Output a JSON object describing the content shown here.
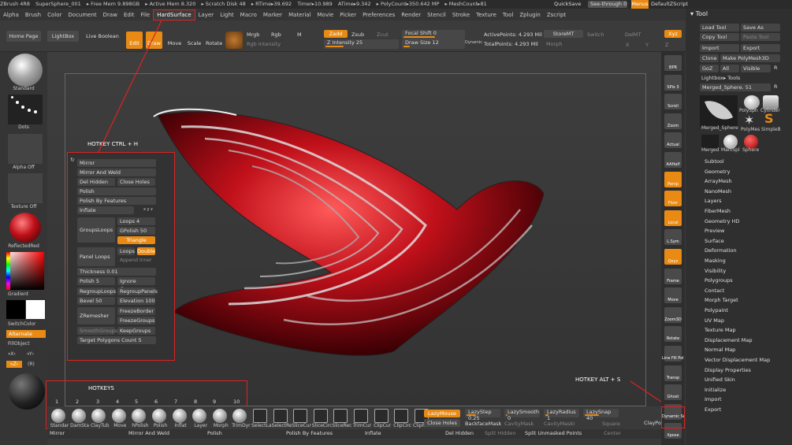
{
  "topbar": {
    "items": [
      "ZBrush 4R8",
      "SuperSphere_001",
      "▸ Free Mem 9.898GB",
      "▸ Active Mem 8.320",
      "▸ Scratch Disk 48",
      "▸ RTime▸39.692",
      "Timer▸10.989",
      "ATime▸9.342",
      "▸ PolyCount▸350.642 MP",
      "▸ MeshCount▸81"
    ],
    "quicksave": "QuickSave",
    "seethrough": "See-through  0",
    "menus": "Menus",
    "default_script": "DefaultZScript"
  },
  "menubar": [
    "Alpha",
    "Brush",
    "Color",
    "Document",
    "Draw",
    "Edit",
    "File",
    "HardSurface",
    "Layer",
    "Light",
    "Macro",
    "Marker",
    "Material",
    "Movie",
    "Picker",
    "Preferences",
    "Render",
    "Stencil",
    "Stroke",
    "Texture",
    "Tool",
    "Zplugin",
    "Zscript"
  ],
  "shelf": {
    "home": "Home Page",
    "lightbox": "LightBox",
    "live_boolean": "Live Boolean",
    "edit": "Edit",
    "draw": "Draw",
    "move": "Move",
    "scale": "Scale",
    "rotate": "Rotate",
    "mrgb": "Mrgb",
    "rgb": "Rgb",
    "m": "M",
    "rgb_intensity": "Rgb Intensity",
    "zadd": "Zadd",
    "zsub": "Zsub",
    "zcut": "Zcut",
    "z_intensity": "Z Intensity 25",
    "z_intensity_value": 25,
    "focal_shift": "Focal Shift 0",
    "draw_size": "Draw Size 12",
    "dynamic": "Dynamic",
    "active_points": "ActivePoints: 4.293 Mil",
    "total_points": "TotalPoints: 4.293 Mil",
    "storemt": "StoreMT",
    "switch": "Switch",
    "delmt": "DelMT",
    "morph": "Morph",
    "xyz": "Xyz",
    "x": "X",
    "y": "Y",
    "z": "Z"
  },
  "left": {
    "standard": "Standard",
    "dots": "Dots",
    "alpha_off": "Alpha Off",
    "texture_off": "Texture Off",
    "reflected_red": "ReflectedRed",
    "gradient": "Gradient",
    "switch_color": "SwitchColor",
    "alternate": "Alternate",
    "fill_object": "FillObject",
    "mx": "»X‹",
    "my": "»Y‹",
    "mz": "»Z‹",
    "mr": "(R)"
  },
  "colors": {
    "accent": "#e88a14",
    "highlight": "#dd2222",
    "model": "#c0101a"
  },
  "hotkey_ctrl_h": "HOTKEY CTRL + H",
  "hotkey_alt_s": "HOTKEY ALT + S",
  "hotkeys_label": "HOTKEYS",
  "popup": {
    "mirror": "Mirror",
    "mirror_weld": "Mirror And Weld",
    "del_hidden": "Del Hidden",
    "close_holes": "Close Holes",
    "polish": "Polish",
    "polish_features": "Polish By Features",
    "inflate": "Inflate",
    "xyz": "x y z",
    "loops": "Loops 4",
    "gpolish": "GPolish 50",
    "triangle": "Triangle",
    "groups_loops": "GroupsLoops",
    "loops2": "Loops",
    "double": "Double",
    "append": "Append",
    "inner": "Inner",
    "panel_loops": "Panel Loops",
    "thickness": "Thickness 0.01",
    "polish5": "Polish 5",
    "ignore_groups": "Ignore Groups",
    "regroup_loops": "RegroupLoops",
    "regroup_panels": "RegroupPanels",
    "bevel": "Bevel 50",
    "elevation": "Elevation 100",
    "freeze_border": "FreezeBorder",
    "zremesher": "ZRemesher",
    "freeze_groups": "FreezeGroups",
    "smooth_groups": "SmoothGroups",
    "keep_groups": "KeepGroups",
    "target_polygons": "Target Polygons Count 5"
  },
  "brushes": {
    "numbers": [
      "1",
      "2",
      "3",
      "4",
      "5",
      "6",
      "7",
      "8",
      "9",
      "10"
    ],
    "names": [
      "Standar",
      "DamSta",
      "ClayTub",
      "Move",
      "hPolish",
      "Polish",
      "Inflat",
      "Layer",
      "Morph",
      "TrimDyr",
      "SelectLa",
      "SelectRe",
      "SliceCur",
      "SliceCirc",
      "SliceRec",
      "TrimCur",
      "ClipCur",
      "ClipCirc",
      "ClipRect"
    ]
  },
  "bottom": {
    "lazymouse": "LazyMouse",
    "lazystep": "LazyStep 0.25",
    "lazysmooth": "LazySmooth 0",
    "lazyradius": "LazyRadius 1",
    "lazysnap": "LazySnap 40",
    "claypol": "ClayPol",
    "close_holes": "Close Holes",
    "backface_mask": "BackfaceMask",
    "cavity_mask": "CavityMask",
    "cavity_mask2": "CavityMaskI",
    "square": "Square",
    "mirror": "Mirror",
    "mirror_weld": "Mirror And Weld",
    "polish": "Polish",
    "polish_features": "Polish By Features",
    "inflate": "Inflate",
    "del_hidden": "Del Hidden",
    "split_hidden": "Split Hidden",
    "split_unmasked": "Split Unmasked Points",
    "center": "Center"
  },
  "rightcol": [
    "BPR",
    "SPix 3",
    "Scroll",
    "Zoom",
    "Actual",
    "AAHalf",
    "Persp",
    "Floor",
    "Local",
    "L.Sym",
    "Qxyz",
    "Frame",
    "Move",
    "Zoom3D",
    "Rotate",
    "Line Fill PolyF",
    "Transp",
    "Ghost",
    "Dynamic Solo",
    "Xpose"
  ],
  "tool": {
    "title": "Tool",
    "load": "Load Tool",
    "save_as": "Save As",
    "copy": "Copy Tool",
    "paste": "Paste Tool",
    "import": "Import",
    "export": "Export",
    "clone": "Clone",
    "make_polymesh": "Make PolyMesh3D",
    "goz": "GoZ",
    "all": "All",
    "visible": "Visible",
    "r": "R",
    "lightbox_tools": "Lightbox▸ Tools",
    "current": "Merged_Sphere. 51",
    "thumbs": [
      "Merged_Sphere",
      "PolySph",
      "Cylinder",
      "PolyMes",
      "SimpleB",
      "Merged",
      "MainSpl",
      "Sphere"
    ],
    "subpalettes": [
      "Subtool",
      "Geometry",
      "ArrayMesh",
      "NanoMesh",
      "Layers",
      "FiberMesh",
      "Geometry HD",
      "Preview",
      "Surface",
      "Deformation",
      "Masking",
      "Visibility",
      "Polygroups",
      "Contact",
      "Morph Target",
      "Polypaint",
      "UV Map",
      "Texture Map",
      "Displacement Map",
      "Normal Map",
      "Vector Displacement Map",
      "Display Properties",
      "Unified Skin",
      "Initialize",
      "Import",
      "Export"
    ]
  }
}
